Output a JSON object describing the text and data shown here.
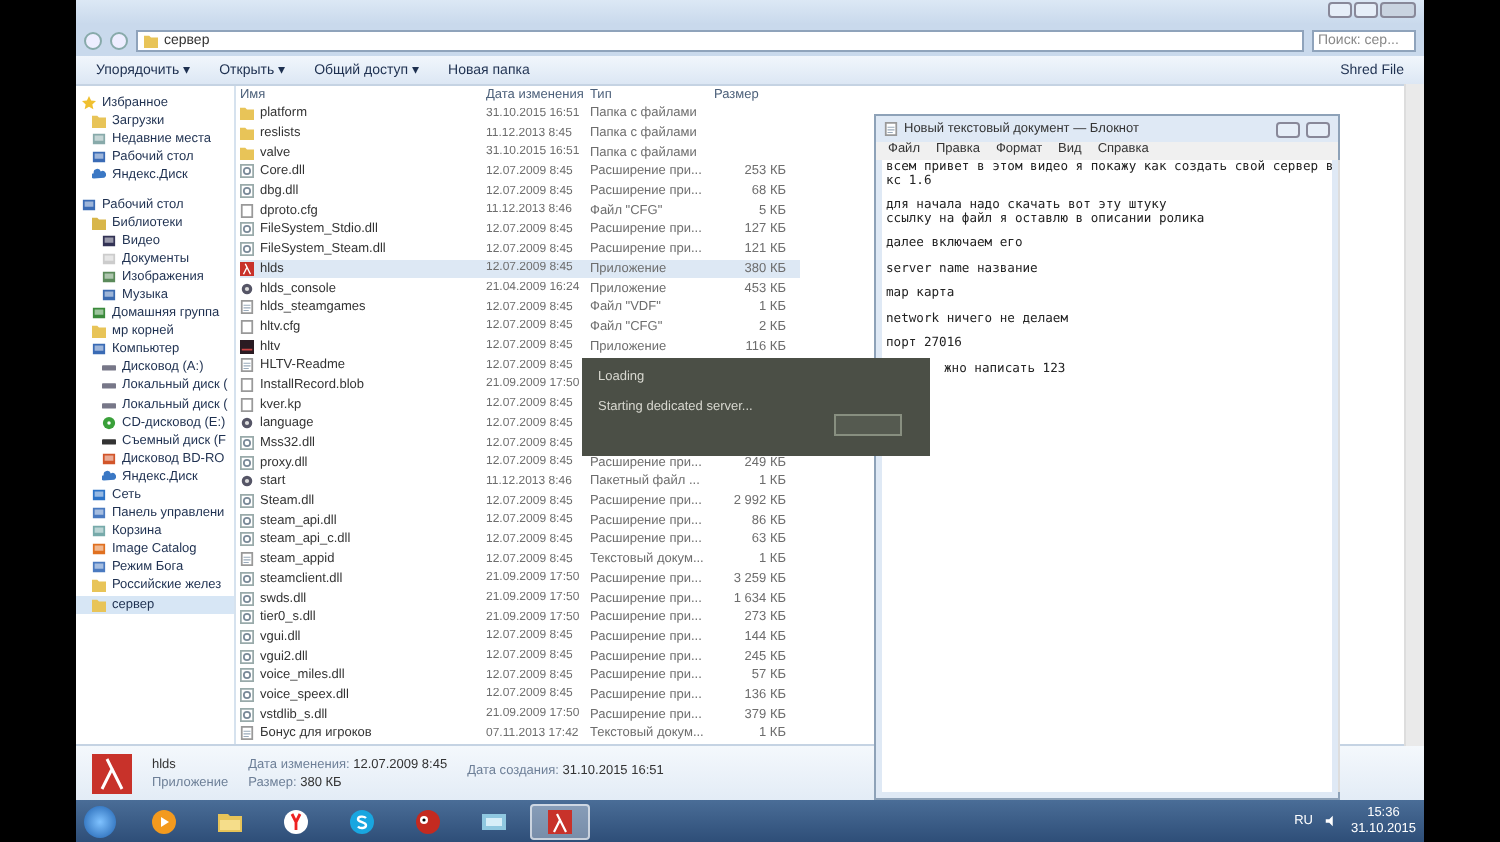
{
  "explorer": {
    "address": "сервер",
    "search": {
      "placeholder": "Поиск: сер..."
    },
    "toolbar": [
      {
        "label": "Упорядочить",
        "caret": "▾"
      },
      {
        "label": "Открыть",
        "caret": "▾"
      },
      {
        "label": "Общий доступ",
        "caret": "▾"
      },
      {
        "label": "Новая папка"
      }
    ],
    "shred": "Shred File",
    "sidebar": [
      {
        "label": "Избранное",
        "kind": "star",
        "selected": false,
        "children": [
          {
            "label": "Загрузки",
            "kind": "folder",
            "selected": false
          },
          {
            "label": "Недавние места",
            "kind": "recent",
            "selected": false
          },
          {
            "label": "Рабочий стол",
            "kind": "desktop",
            "selected": false
          },
          {
            "label": "Яндекс.Диск",
            "kind": "cloud",
            "selected": false
          }
        ]
      },
      {
        "label": "Рабочий стол",
        "kind": "desktop",
        "selected": false,
        "children": [
          {
            "label": "Библиотеки",
            "kind": "library",
            "selected": false,
            "children": [
              {
                "label": "Видео",
                "kind": "video",
                "selected": false
              },
              {
                "label": "Документы",
                "kind": "doc",
                "selected": false
              },
              {
                "label": "Изображения",
                "kind": "image",
                "selected": false
              },
              {
                "label": "Музыка",
                "kind": "music",
                "selected": false
              }
            ]
          },
          {
            "label": "Домашняя группа",
            "kind": "group",
            "selected": false
          },
          {
            "label": "мр корней",
            "kind": "folder",
            "selected": false
          },
          {
            "label": "Компьютер",
            "kind": "computer",
            "selected": false,
            "children": [
              {
                "label": "Дисковод (A:)",
                "kind": "drive",
                "selected": false
              },
              {
                "label": "Локальный диск (",
                "kind": "drive",
                "selected": false
              },
              {
                "label": "Локальный диск (",
                "kind": "drive",
                "selected": false
              },
              {
                "label": "CD-дисковод (E:)",
                "kind": "disc",
                "selected": false
              },
              {
                "label": "Съемный диск (F",
                "kind": "usb",
                "selected": false
              },
              {
                "label": "Дисковод BD-RO",
                "kind": "bd",
                "selected": false
              },
              {
                "label": "Яндекс.Диск",
                "kind": "cloud",
                "selected": false
              }
            ]
          },
          {
            "label": "Сеть",
            "kind": "network",
            "selected": false
          },
          {
            "label": "Панель управлени",
            "kind": "control",
            "selected": false
          },
          {
            "label": "Корзина",
            "kind": "trash",
            "selected": false
          },
          {
            "label": "Image Catalog",
            "kind": "app",
            "selected": false
          },
          {
            "label": "Режим Бога",
            "kind": "control",
            "selected": false
          },
          {
            "label": "Российские желез",
            "kind": "folder",
            "selected": false
          },
          {
            "label": "сервер",
            "kind": "folder",
            "selected": true
          }
        ]
      }
    ],
    "columns": [
      "Имя",
      "Дата изменения",
      "Тип",
      "Размер"
    ],
    "files": [
      {
        "name": "platform",
        "date": "31.10.2015 16:51",
        "type": "Папка с файлами",
        "kind": "folder",
        "selected": false
      },
      {
        "name": "reslists",
        "date": "11.12.2013 8:45",
        "type": "Папка с файлами",
        "kind": "folder",
        "selected": false
      },
      {
        "name": "valve",
        "date": "31.10.2015 16:51",
        "type": "Папка с файлами",
        "kind": "folder",
        "selected": false
      },
      {
        "name": "Core.dll",
        "date": "12.07.2009 8:45",
        "type": "Расширение при...",
        "size": "253 КБ",
        "kind": "dll",
        "selected": false
      },
      {
        "name": "dbg.dll",
        "date": "12.07.2009 8:45",
        "type": "Расширение при...",
        "size": "68 КБ",
        "kind": "dll",
        "selected": false
      },
      {
        "name": "dproto.cfg",
        "date": "11.12.2013 8:46",
        "type": "Файл \"CFG\"",
        "size": "5 КБ",
        "kind": "file",
        "selected": false
      },
      {
        "name": "FileSystem_Stdio.dll",
        "date": "12.07.2009 8:45",
        "type": "Расширение при...",
        "size": "127 КБ",
        "kind": "dll",
        "selected": false
      },
      {
        "name": "FileSystem_Steam.dll",
        "date": "12.07.2009 8:45",
        "type": "Расширение при...",
        "size": "121 КБ",
        "kind": "dll",
        "selected": false
      },
      {
        "name": "hlds",
        "date": "12.07.2009 8:45",
        "type": "Приложение",
        "size": "380 КБ",
        "kind": "hl",
        "selected": true
      },
      {
        "name": "hlds_console",
        "date": "21.04.2009 16:24",
        "type": "Приложение",
        "size": "453 КБ",
        "kind": "gear",
        "selected": false
      },
      {
        "name": "hlds_steamgames",
        "date": "12.07.2009 8:45",
        "type": "Файл \"VDF\"",
        "size": "1 КБ",
        "kind": "text",
        "selected": false
      },
      {
        "name": "hltv.cfg",
        "date": "12.07.2009 8:45",
        "type": "Файл \"CFG\"",
        "size": "2 КБ",
        "kind": "file",
        "selected": false
      },
      {
        "name": "hltv",
        "date": "12.07.2009 8:45",
        "type": "Приложение",
        "size": "116 КБ",
        "kind": "hltv",
        "selected": false
      },
      {
        "name": "HLTV-Readme",
        "date": "12.07.2009 8:45",
        "kind": "text",
        "selected": false
      },
      {
        "name": "InstallRecord.blob",
        "date": "21.09.2009 17:50",
        "kind": "file",
        "selected": false
      },
      {
        "name": "kver.kp",
        "date": "12.07.2009 8:45",
        "kind": "file",
        "selected": false
      },
      {
        "name": "language",
        "date": "12.07.2009 8:45",
        "kind": "gear",
        "selected": false
      },
      {
        "name": "Mss32.dll",
        "date": "12.07.2009 8:45",
        "kind": "dll",
        "selected": false
      },
      {
        "name": "proxy.dll",
        "date": "12.07.2009 8:45",
        "type": "Расширение при...",
        "size": "249 КБ",
        "kind": "dll",
        "selected": false
      },
      {
        "name": "start",
        "date": "11.12.2013 8:46",
        "type": "Пакетный файл ...",
        "size": "1 КБ",
        "kind": "gear",
        "selected": false
      },
      {
        "name": "Steam.dll",
        "date": "12.07.2009 8:45",
        "type": "Расширение при...",
        "size": "2 992 КБ",
        "kind": "dll",
        "selected": false
      },
      {
        "name": "steam_api.dll",
        "date": "12.07.2009 8:45",
        "type": "Расширение при...",
        "size": "86 КБ",
        "kind": "dll",
        "selected": false
      },
      {
        "name": "steam_api_c.dll",
        "date": "12.07.2009 8:45",
        "type": "Расширение при...",
        "size": "63 КБ",
        "kind": "dll",
        "selected": false
      },
      {
        "name": "steam_appid",
        "date": "12.07.2009 8:45",
        "type": "Текстовый докум...",
        "size": "1 КБ",
        "kind": "text",
        "selected": false
      },
      {
        "name": "steamclient.dll",
        "date": "21.09.2009 17:50",
        "type": "Расширение при...",
        "size": "3 259 КБ",
        "kind": "dll",
        "selected": false
      },
      {
        "name": "swds.dll",
        "date": "21.09.2009 17:50",
        "type": "Расширение при...",
        "size": "1 634 КБ",
        "kind": "dll",
        "selected": false
      },
      {
        "name": "tier0_s.dll",
        "date": "21.09.2009 17:50",
        "type": "Расширение при...",
        "size": "273 КБ",
        "kind": "dll",
        "selected": false
      },
      {
        "name": "vgui.dll",
        "date": "12.07.2009 8:45",
        "type": "Расширение при...",
        "size": "144 КБ",
        "kind": "dll",
        "selected": false
      },
      {
        "name": "vgui2.dll",
        "date": "12.07.2009 8:45",
        "type": "Расширение при...",
        "size": "245 КБ",
        "kind": "dll",
        "selected": false
      },
      {
        "name": "voice_miles.dll",
        "date": "12.07.2009 8:45",
        "type": "Расширение при...",
        "size": "57 КБ",
        "kind": "dll",
        "selected": false
      },
      {
        "name": "voice_speex.dll",
        "date": "12.07.2009 8:45",
        "type": "Расширение при...",
        "size": "136 КБ",
        "kind": "dll",
        "selected": false
      },
      {
        "name": "vstdlib_s.dll",
        "date": "21.09.2009 17:50",
        "type": "Расширение при...",
        "size": "379 КБ",
        "kind": "dll",
        "selected": false
      },
      {
        "name": "Бонус для игроков",
        "date": "07.11.2013 17:42",
        "type": "Текстовый докум...",
        "size": "1 КБ",
        "kind": "text",
        "selected": false
      }
    ],
    "details": {
      "name": "hlds",
      "type": "Приложение",
      "modified_label": "Дата изменения:",
      "modified": "12.07.2009 8:45",
      "size_label": "Размер:",
      "size": "380 КБ",
      "created_label": "Дата создания:",
      "created": "31.10.2015 16:51"
    }
  },
  "notepad": {
    "title": "Новый текстовый документ — Блокнот",
    "menu": [
      "Файл",
      "Правка",
      "Формат",
      "Вид",
      "Справка"
    ],
    "paragraphs": [
      [
        "всем привет в этом видео я покажу как создать свой сервер в",
        "кс 1.6"
      ],
      [
        "для начала надо скачать вот эту штуку",
        "ссылку на файл я оставлю в описании ролика"
      ],
      [
        "далее включаем его"
      ],
      [
        "server name название"
      ],
      [
        "map карта"
      ],
      [
        "network ничего не делаем"
      ],
      [
        "порт 27016"
      ]
    ],
    "covered_line": "жно написать 123"
  },
  "dialog": {
    "title": "Loading",
    "message": "Starting dedicated server..."
  },
  "taskbar": {
    "items": [
      {
        "kind": "media",
        "selected": false
      },
      {
        "kind": "explorer",
        "selected": false
      },
      {
        "kind": "yandex",
        "selected": false
      },
      {
        "kind": "skype",
        "selected": false
      },
      {
        "kind": "bird",
        "selected": false
      },
      {
        "kind": "window",
        "selected": false
      },
      {
        "kind": "hl",
        "selected": true
      }
    ],
    "language": "RU",
    "time": "15:36",
    "date": "31.10.2015"
  }
}
